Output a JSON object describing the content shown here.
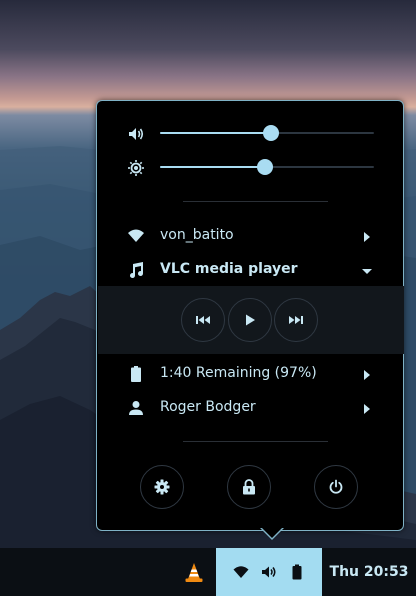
{
  "panel": {
    "volume_level": 0.52,
    "brightness_level": 0.49
  },
  "network": {
    "label": "von_batito",
    "icon": "wifi-icon"
  },
  "media": {
    "label": "VLC media player",
    "icon": "music-note-icon",
    "controls": [
      "previous-icon",
      "play-icon",
      "next-icon"
    ]
  },
  "battery": {
    "label": "1:40 Remaining (97%)",
    "icon": "battery-icon",
    "level_percent": 97
  },
  "user": {
    "label": "Roger Bodger",
    "icon": "user-icon"
  },
  "actions": [
    "settings-icon",
    "lock-icon",
    "power-icon"
  ],
  "taskbar": {
    "app_icon": "vlc-icon",
    "tray_icons": [
      "wifi-icon",
      "volume-icon",
      "battery-icon"
    ],
    "clock": "Thu 20:53"
  },
  "colors": {
    "accent": "#a9dcf2",
    "tray_background": "#a3dcf1",
    "menu_background": "#000000",
    "menu_border": "#7fb2c6"
  }
}
